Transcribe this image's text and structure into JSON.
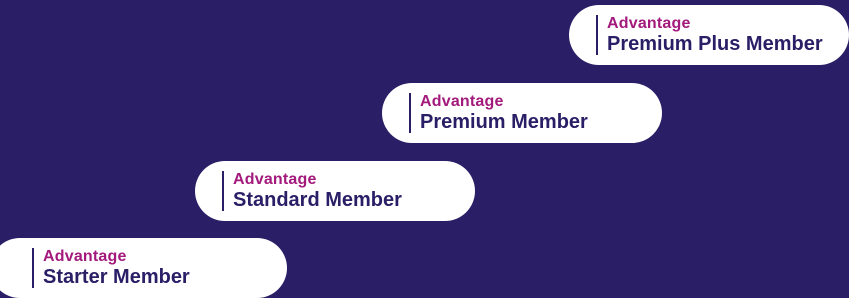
{
  "colors": {
    "background": "#2a1e66",
    "pill": "#ffffff",
    "brand": "#a3197c",
    "tier": "#2a1e66"
  },
  "tiers": [
    {
      "brand": "Advantage",
      "name": "Starter Member"
    },
    {
      "brand": "Advantage",
      "name": "Standard Member"
    },
    {
      "brand": "Advantage",
      "name": "Premium Member"
    },
    {
      "brand": "Advantage",
      "name": "Premium Plus Member"
    }
  ]
}
